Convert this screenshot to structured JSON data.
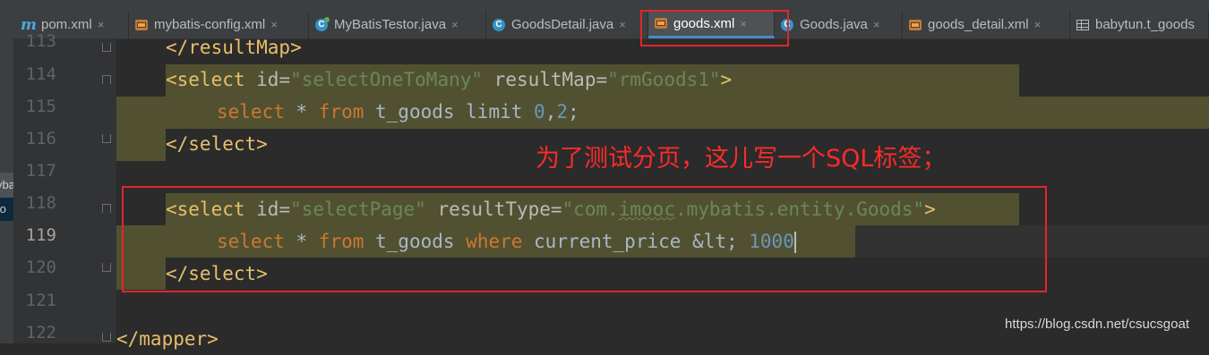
{
  "tabs": [
    {
      "label": "pom.xml",
      "icon": "maven-icon"
    },
    {
      "label": "mybatis-config.xml",
      "icon": "xml-file-icon"
    },
    {
      "label": "MyBatisTestor.java",
      "icon": "java-class-icon"
    },
    {
      "label": "GoodsDetail.java",
      "icon": "java-class-icon"
    },
    {
      "label": "goods.xml",
      "icon": "xml-file-icon",
      "active": true
    },
    {
      "label": "Goods.java",
      "icon": "java-class-icon"
    },
    {
      "label": "goods_detail.xml",
      "icon": "xml-file-icon"
    },
    {
      "label": "babytun.t_goods",
      "icon": "table-icon"
    }
  ],
  "close_glyph": "×",
  "left_panel": {
    "frag1": "yba",
    "frag2": "to"
  },
  "lines": [
    {
      "num": "113"
    },
    {
      "num": "114"
    },
    {
      "num": "115"
    },
    {
      "num": "116"
    },
    {
      "num": "117"
    },
    {
      "num": "118"
    },
    {
      "num": "119"
    },
    {
      "num": "120"
    },
    {
      "num": "121"
    },
    {
      "num": "122"
    }
  ],
  "code": {
    "l113": "</resultMap>",
    "l114": {
      "open": "<select",
      "a1": " id=",
      "v1": "\"selectOneToMany\"",
      "a2": " resultMap=",
      "v2": "\"rmGoods1\"",
      "close": ">"
    },
    "l115": {
      "k1": "select",
      "t1": " * ",
      "k2": "from",
      "t2": " t_goods limit ",
      "n1": "0",
      "t3": ",",
      "n2": "2",
      "t4": ";"
    },
    "l116": "</select>",
    "l118": {
      "open": "<select",
      "a1": " id=",
      "v1": "\"selectPage\"",
      "a2": " resultType=",
      "v2a": "\"com.",
      "v2b": "imooc",
      "v2c": ".mybatis.entity.Goods\"",
      "close": ">"
    },
    "l119": {
      "k1": "select",
      "t1": " * ",
      "k2": "from",
      "t2": " t_goods ",
      "k3": "where",
      "t3": " current_price &lt; ",
      "n1": "1000"
    },
    "l120": "</select>",
    "l122": "</mapper>"
  },
  "annotation": "为了测试分页，这儿写一个SQL标签；",
  "watermark": "https://blog.csdn.net/csucsgoat",
  "colors": {
    "annotation": "#ff2a2a",
    "highlight_box": "#e0262b",
    "active_tab_underline": "#4a88c7"
  }
}
